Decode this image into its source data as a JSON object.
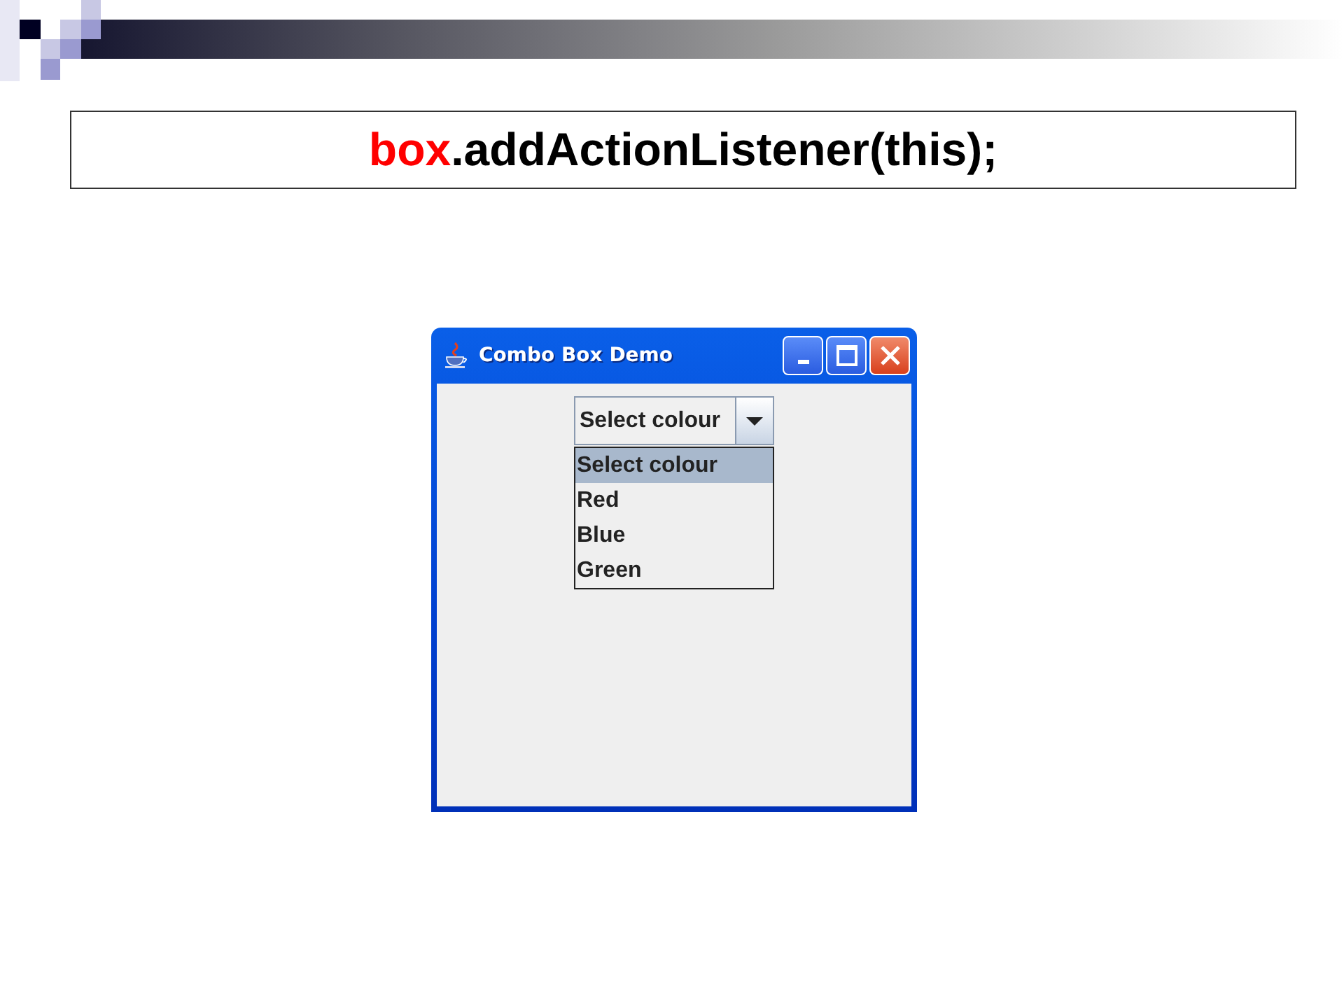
{
  "slide": {
    "code": [
      {
        "text": "box",
        "color": "#ff0000"
      },
      {
        "text": ".addActionListener(this);",
        "color": "#000000"
      }
    ]
  },
  "window": {
    "title": "Combo Box Demo"
  },
  "combo_box": {
    "value": "Select colour",
    "expanded": true,
    "options": [
      {
        "label": "Select colour",
        "selected": true
      },
      {
        "label": "Red",
        "selected": false
      },
      {
        "label": "Blue",
        "selected": false
      },
      {
        "label": "Green",
        "selected": false
      }
    ]
  }
}
